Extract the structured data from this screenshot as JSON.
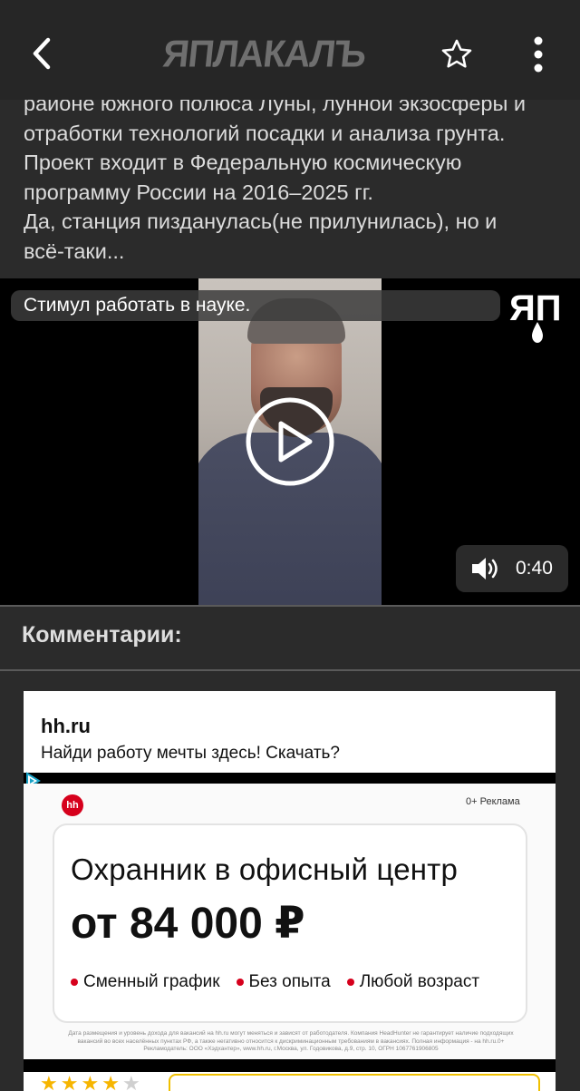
{
  "header": {
    "logo_text": "ЯПЛАКАЛЪ",
    "back_icon": "chevron-left-icon",
    "star_icon": "star-outline-icon",
    "menu_icon": "kebab-menu-icon"
  },
  "post": {
    "lines": [
      "районе южного полюса Луны, лунной экзосферы и",
      "отработки технологий посадки и анализа грунта.",
      "Проект входит в Федеральную космическую",
      "программу России на 2016–2025 гг.",
      "Да, станция пизданулась(не прилунилась), но и",
      "всё-таки..."
    ]
  },
  "video": {
    "caption": "Стимул работать в науке.",
    "logo_text": "ЯП",
    "duration": "0:40",
    "play_icon": "play-circle-icon",
    "sound_icon": "speaker-icon"
  },
  "comments": {
    "title": "Комментарии:"
  },
  "ad": {
    "domain": "hh.ru",
    "description": "Найди работу мечты здесь! Скачать?",
    "badge": "hh",
    "tag": "0+  Реклама",
    "job_title": "Охранник в офисный центр",
    "salary": "от 84 000 ₽",
    "features": [
      "Сменный график",
      "Без опыта",
      "Любой возраст"
    ],
    "legal": "Дата размещения и уровень дохода для вакансий на hh.ru могут меняться и зависят от работодателя. Компания HeadHunter не гарантирует наличие подходящих вакансий во всех населённых пунктах РФ, а также негативно относится к дискриминационным требованиям в вакансиях. Полная информация - на hh.ru.0+ Рекламодатель: ООО «Хэдхантер», www.hh.ru, г.Москва, ул. Годовикова, д.9, стр. 10, ОГРН 1067761906805",
    "rating": 4,
    "rating_max": 5,
    "accent_color": "#d6001c"
  }
}
